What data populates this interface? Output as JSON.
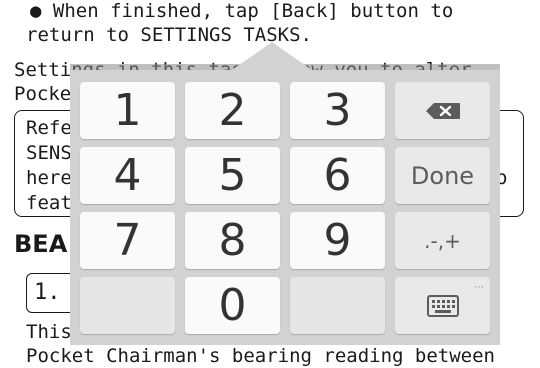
{
  "document": {
    "bullet_text": "When finished, tap [Back] button to",
    "bullet_text_cont": "return to SETTINGS TASKS.",
    "para1_line1": "Settings in this task allow you to alter",
    "para1_line2": "Pocke",
    "ref_line1": "Refe",
    "ref_line2": "SENS",
    "ref_line3": "here",
    "ref_line4": "feat",
    "ref_tail": "o",
    "heading": "BEA",
    "step_label": "1.",
    "para2_line1": "This",
    "para2_line2": "Pocket Chairman's bearing reading between"
  },
  "keypad": {
    "keys": {
      "k1": "1",
      "k2": "2",
      "k3": "3",
      "k4": "4",
      "k5": "5",
      "k6": "6",
      "k7": "7",
      "k8": "8",
      "k9": "9",
      "k0": "0",
      "done": "Done",
      "symbols": ".-,+"
    },
    "icons": {
      "backspace": "backspace-icon",
      "keyboard": "keyboard-icon"
    },
    "colors": {
      "panel": "#d2d2d2",
      "key": "#fafafa",
      "func_key": "#e9e9e9"
    }
  }
}
